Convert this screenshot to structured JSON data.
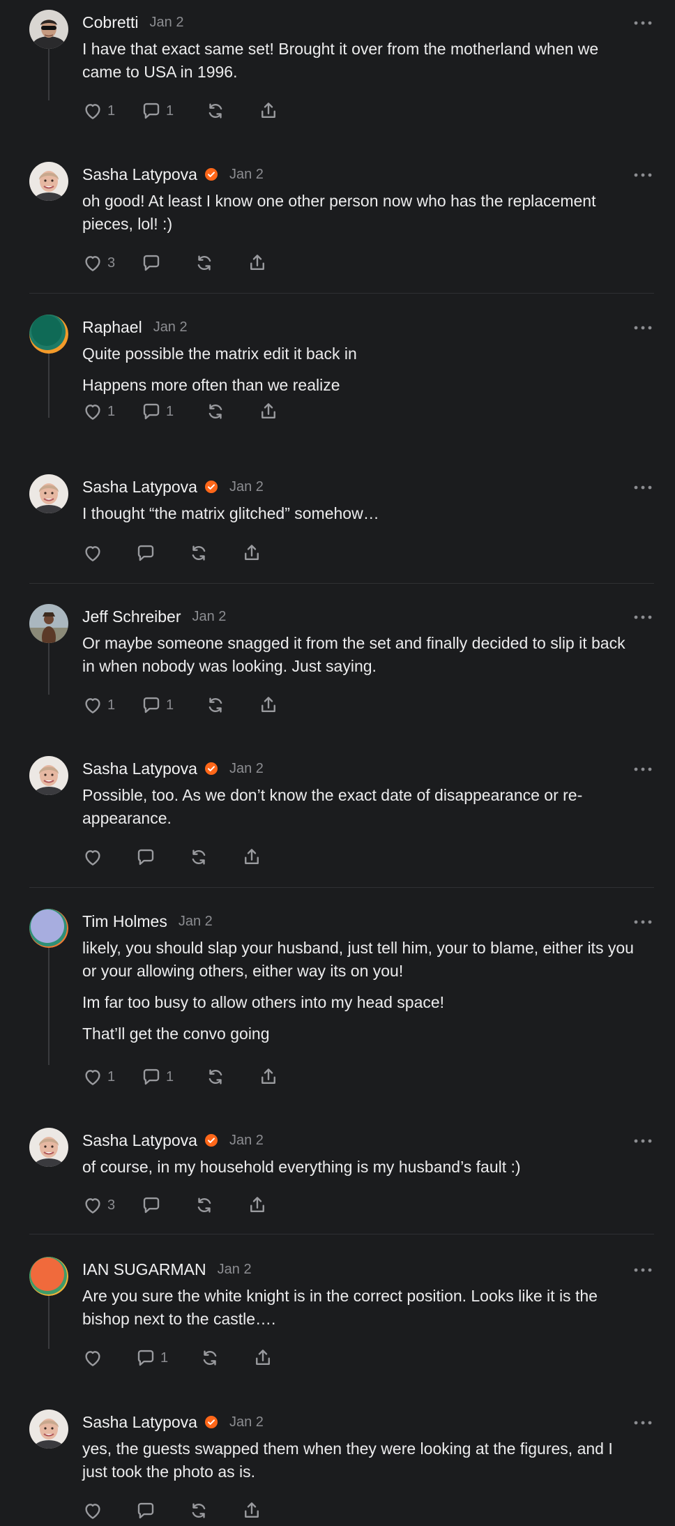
{
  "colors": {
    "background": "#1b1c1e",
    "verified_badge": "#ff6719",
    "muted_text": "#8c8d91"
  },
  "comments": [
    {
      "author": "Cobretti",
      "date": "Jan 2",
      "verified": false,
      "avatar": "cobretti-photo",
      "paragraphs": [
        "I have that exact same set! Brought it over from the motherland when we came to USA in 1996."
      ],
      "likes": "1",
      "replies": "1"
    },
    {
      "author": "Sasha Latypova",
      "date": "Jan 2",
      "verified": true,
      "avatar": "sasha-photo",
      "paragraphs": [
        "oh good! At least I know one other person now who has the replacement pieces, lol! :)"
      ],
      "likes": "3",
      "replies": ""
    },
    {
      "author": "Raphael",
      "date": "Jan 2",
      "verified": false,
      "avatar": "green-orange-circle",
      "paragraphs": [
        "Quite possible the matrix edit it back in",
        "Happens more often than we realize"
      ],
      "likes": "1",
      "replies": "1"
    },
    {
      "author": "Sasha Latypova",
      "date": "Jan 2",
      "verified": true,
      "avatar": "sasha-photo",
      "paragraphs": [
        "I thought “the matrix glitched” somehow…"
      ],
      "likes": "",
      "replies": ""
    },
    {
      "author": "Jeff Schreiber",
      "date": "Jan 2",
      "verified": false,
      "avatar": "jeff-photo",
      "paragraphs": [
        "Or maybe someone snagged it from the set and finally decided to slip it back in when nobody was looking. Just saying."
      ],
      "likes": "1",
      "replies": "1"
    },
    {
      "author": "Sasha Latypova",
      "date": "Jan 2",
      "verified": true,
      "avatar": "sasha-photo",
      "paragraphs": [
        "Possible, too. As we don’t know the exact date of disappearance or re-appearance."
      ],
      "likes": "",
      "replies": ""
    },
    {
      "author": "Tim Holmes",
      "date": "Jan 2",
      "verified": false,
      "avatar": "lavender-circle",
      "paragraphs": [
        "likely, you should slap your husband, just tell him, your to blame, either its you or your allowing others, either way its on you!",
        "Im far too busy to allow others into my head space!",
        "That’ll get the convo going"
      ],
      "likes": "1",
      "replies": "1"
    },
    {
      "author": "Sasha Latypova",
      "date": "Jan 2",
      "verified": true,
      "avatar": "sasha-photo",
      "paragraphs": [
        "of course, in my household everything is my husband’s fault :)"
      ],
      "likes": "3",
      "replies": ""
    },
    {
      "author": "IAN SUGARMAN",
      "date": "Jan 2",
      "verified": false,
      "avatar": "orange-red-circle",
      "paragraphs": [
        "Are you sure the white knight is in the correct position. Looks like it is the bishop next to the castle…."
      ],
      "likes": "",
      "replies": "1"
    },
    {
      "author": "Sasha Latypova",
      "date": "Jan 2",
      "verified": true,
      "avatar": "sasha-photo",
      "paragraphs": [
        "yes, the guests swapped them when they were looking at the figures, and I just took the photo as is."
      ],
      "likes": "",
      "replies": ""
    }
  ]
}
